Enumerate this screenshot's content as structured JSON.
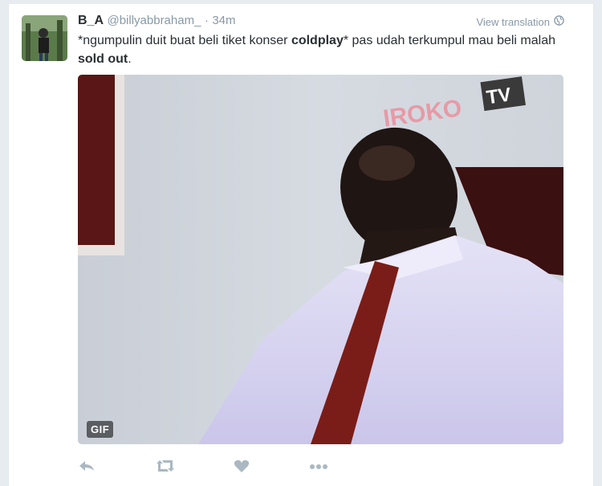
{
  "tweet": {
    "fullname": "B_A",
    "username": "@billyabbraham_",
    "separator": "·",
    "time": "34m",
    "view_translation": "View translation",
    "text_parts": [
      {
        "text": "*ngumpulin duit buat beli tiket konser ",
        "bold": false
      },
      {
        "text": "coldplay",
        "bold": true
      },
      {
        "text": "* pas udah terkumpul mau beli malah ",
        "bold": false
      },
      {
        "text": "sold out",
        "bold": true
      },
      {
        "text": ".",
        "bold": false
      }
    ],
    "media": {
      "gif_badge": "GIF",
      "watermark": "IROKO",
      "watermark_tv": "TV"
    }
  },
  "actions": {
    "icons": [
      "reply-icon",
      "retweet-icon",
      "like-icon",
      "more-icon"
    ]
  },
  "colors": {
    "accent": "#8899a6",
    "text": "#292f33",
    "background": "#e6ecf0"
  }
}
